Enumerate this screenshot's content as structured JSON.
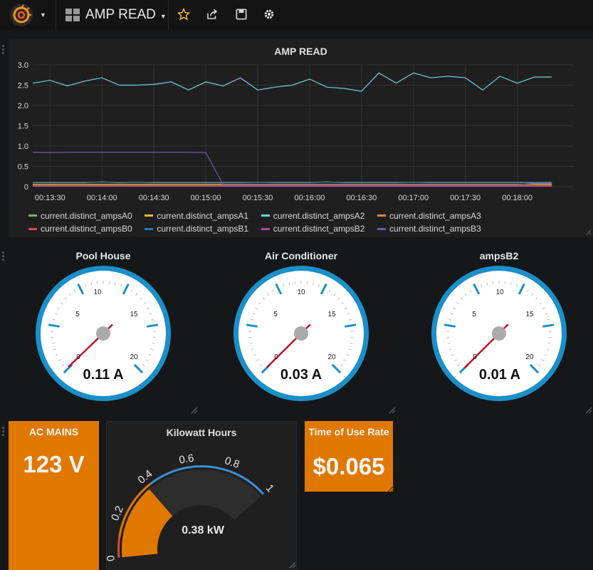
{
  "navbar": {
    "dashboard_title": "AMP READ",
    "icons": [
      "grafana-logo-icon",
      "star-icon",
      "share-icon",
      "save-icon",
      "gear-icon"
    ]
  },
  "graph_panel": {
    "title": "AMP READ",
    "legend": [
      {
        "name": "current.distinct_ampsA0",
        "color": "#7eb26d"
      },
      {
        "name": "current.distinct_ampsA1",
        "color": "#eab839"
      },
      {
        "name": "current.distinct_ampsA2",
        "color": "#6ed0e0"
      },
      {
        "name": "current.distinct_ampsA3",
        "color": "#ef843c"
      },
      {
        "name": "current.distinct_ampsB0",
        "color": "#e24d42"
      },
      {
        "name": "current.distinct_ampsB1",
        "color": "#1f78c1"
      },
      {
        "name": "current.distinct_ampsB2",
        "color": "#ba43a9"
      },
      {
        "name": "current.distinct_ampsB3",
        "color": "#705da0"
      }
    ]
  },
  "chart_data": {
    "type": "line",
    "x": [
      "00:13:20",
      "00:13:30",
      "00:13:40",
      "00:13:50",
      "00:14:00",
      "00:14:10",
      "00:14:20",
      "00:14:30",
      "00:14:40",
      "00:14:50",
      "00:15:00",
      "00:15:10",
      "00:15:20",
      "00:15:30",
      "00:15:40",
      "00:15:50",
      "00:16:00",
      "00:16:10",
      "00:16:20",
      "00:16:30",
      "00:16:40",
      "00:16:50",
      "00:17:00",
      "00:17:10",
      "00:17:20",
      "00:17:30",
      "00:17:40",
      "00:17:50",
      "00:18:00",
      "00:18:10",
      "00:18:20"
    ],
    "x_ticks": [
      "00:13:30",
      "00:14:00",
      "00:14:30",
      "00:15:00",
      "00:15:30",
      "00:16:00",
      "00:16:30",
      "00:17:00",
      "00:17:30",
      "00:18:00"
    ],
    "ylim": [
      0,
      3
    ],
    "y_ticks": [
      "0",
      "0.5",
      "1.0",
      "1.5",
      "2.0",
      "2.5",
      "3.0"
    ],
    "grid": true,
    "legend_position": "bottom",
    "series": [
      {
        "name": "current.distinct_ampsA0",
        "values": [
          0.1,
          0.1,
          0.1,
          0.1,
          0.12,
          0.1,
          0.11,
          0.1,
          0.1,
          0.1,
          0.1,
          0.1,
          0.1,
          0.11,
          0.1,
          0.1,
          0.1,
          0.12,
          0.1,
          0.1,
          0.1,
          0.1,
          0.11,
          0.1,
          0.1,
          0.1,
          0.1,
          0.1,
          0.1,
          0.1,
          0.1
        ]
      },
      {
        "name": "current.distinct_ampsA1",
        "values": [
          0.06,
          0.06,
          0.06,
          0.06,
          0.06,
          0.06,
          0.06,
          0.06,
          0.06,
          0.06,
          0.06,
          0.06,
          0.06,
          0.06,
          0.06,
          0.06,
          0.06,
          0.06,
          0.06,
          0.06,
          0.06,
          0.06,
          0.06,
          0.06,
          0.06,
          0.06,
          0.06,
          0.06,
          0.06,
          0.06,
          0.06
        ]
      },
      {
        "name": "current.distinct_ampsA2",
        "values": [
          2.55,
          2.62,
          2.48,
          2.6,
          2.68,
          2.5,
          2.5,
          2.52,
          2.58,
          2.38,
          2.58,
          2.48,
          2.68,
          2.38,
          2.45,
          2.5,
          2.65,
          2.45,
          2.42,
          2.35,
          2.8,
          2.55,
          2.8,
          2.68,
          2.72,
          2.68,
          2.38,
          2.72,
          2.55,
          2.7,
          2.7
        ]
      },
      {
        "name": "current.distinct_ampsA3",
        "values": [
          0.03,
          0.03,
          0.03,
          0.03,
          0.03,
          0.03,
          0.03,
          0.03,
          0.03,
          0.03,
          0.03,
          0.03,
          0.03,
          0.03,
          0.03,
          0.03,
          0.03,
          0.03,
          0.03,
          0.03,
          0.03,
          0.03,
          0.03,
          0.03,
          0.03,
          0.03,
          0.03,
          0.03,
          0.03,
          0.03,
          0.03
        ]
      },
      {
        "name": "current.distinct_ampsB0",
        "values": [
          0.02,
          0.02,
          0.02,
          0.02,
          0.02,
          0.02,
          0.02,
          0.02,
          0.02,
          0.02,
          0.02,
          0.02,
          0.02,
          0.02,
          0.02,
          0.02,
          0.02,
          0.02,
          0.02,
          0.02,
          0.02,
          0.02,
          0.02,
          0.02,
          0.02,
          0.02,
          0.02,
          0.02,
          0.02,
          0.02,
          0.02
        ]
      },
      {
        "name": "current.distinct_ampsB1",
        "values": [
          0.11,
          0.11,
          0.11,
          0.11,
          0.11,
          0.11,
          0.11,
          0.11,
          0.11,
          0.11,
          0.11,
          0.11,
          0.11,
          0.11,
          0.11,
          0.11,
          0.11,
          0.11,
          0.11,
          0.11,
          0.11,
          0.11,
          0.11,
          0.11,
          0.11,
          0.11,
          0.11,
          0.11,
          0.11,
          0.11,
          0.11
        ]
      },
      {
        "name": "current.distinct_ampsB2",
        "values": [
          0.01,
          0.01,
          0.01,
          0.01,
          0.01,
          0.01,
          0.01,
          0.01,
          0.01,
          0.01,
          0.01,
          0.01,
          0.01,
          0.01,
          0.01,
          0.01,
          0.01,
          0.01,
          0.01,
          0.01,
          0.01,
          0.01,
          0.01,
          0.01,
          0.01,
          0.01,
          0.01,
          0.01,
          0.01,
          0.01,
          0.01
        ]
      },
      {
        "name": "current.distinct_ampsB3",
        "values": [
          0.85,
          0.84,
          0.85,
          0.85,
          0.85,
          0.85,
          0.85,
          0.85,
          0.85,
          0.85,
          0.84,
          0.05,
          0.05,
          0.05,
          0.05,
          0.05,
          0.05,
          0.05,
          0.05,
          0.05,
          0.05,
          0.05,
          0.05,
          0.05,
          0.05,
          0.05,
          0.05,
          0.05,
          0.05,
          0.08,
          0.08
        ]
      }
    ]
  },
  "gauges": [
    {
      "title": "Pool House",
      "value": 0.11,
      "value_text": "0.11 A",
      "min": 0,
      "max": 25,
      "labels": [
        "0",
        "5",
        "10",
        "15",
        "20"
      ]
    },
    {
      "title": "Air Conditioner",
      "value": 0.03,
      "value_text": "0.03 A",
      "min": 0,
      "max": 25,
      "labels": [
        "0",
        "5",
        "10",
        "15",
        "20"
      ]
    },
    {
      "title": "ampsB2",
      "value": 0.01,
      "value_text": "0.01 A",
      "min": 0,
      "max": 25,
      "labels": [
        "0",
        "5",
        "10",
        "15",
        "20"
      ]
    }
  ],
  "stat_ac_mains": {
    "label": "AC MAINS",
    "value": "123 V",
    "color": "#e07800"
  },
  "stat_kwh": {
    "title": "Kilowatt Hours",
    "value": 0.38,
    "value_text": "0.38 kW",
    "min": 0,
    "max": 1,
    "threshold_labels": [
      "0",
      "0.2",
      "0.4",
      "0.6",
      "0.8",
      "1"
    ],
    "colors": {
      "low": "#d44a3a",
      "mid": "#e07800",
      "high": "#299c46",
      "blue": "#3d8fd4"
    }
  },
  "stat_tou": {
    "label": "Time of Use Rate",
    "value": "$0.065",
    "color": "#e07800"
  }
}
